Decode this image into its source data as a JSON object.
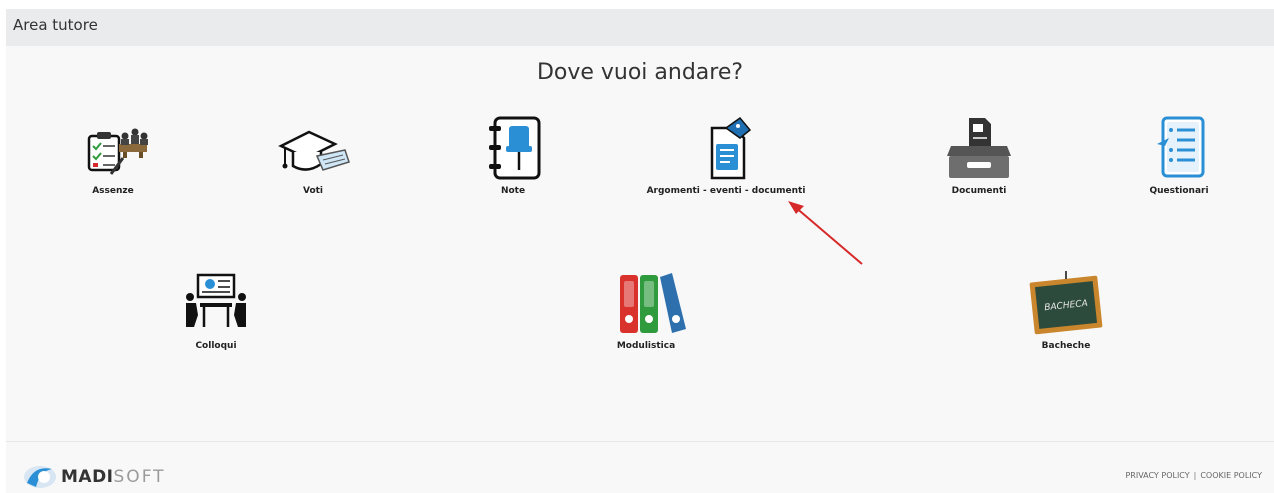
{
  "header": {
    "title": "Area tutore"
  },
  "main": {
    "heading": "Dove vuoi andare?",
    "tiles": [
      {
        "label": "Assenze",
        "icon": "attendance-icon"
      },
      {
        "label": "Voti",
        "icon": "graduation-cap-icon"
      },
      {
        "label": "Note",
        "icon": "notebook-pin-icon"
      },
      {
        "label": "Argomenti - eventi - documenti",
        "icon": "document-tag-icon"
      },
      {
        "label": "Documenti",
        "icon": "document-tray-icon"
      },
      {
        "label": "Questionari",
        "icon": "questionnaire-icon"
      },
      {
        "label": "Colloqui",
        "icon": "meeting-icon"
      },
      {
        "label": "Modulistica",
        "icon": "binders-icon"
      },
      {
        "label": "Bacheche",
        "icon": "blackboard-icon",
        "board_text": "BACHECA"
      }
    ]
  },
  "footer": {
    "logo_bold": "MADI",
    "logo_light": "SOFT",
    "privacy": "PRIVACY POLICY",
    "separator": "|",
    "cookie": "COOKIE POLICY"
  },
  "colors": {
    "accent_blue": "#2b8fd6",
    "arrow_red": "#d62a2a",
    "binder_red": "#d9322c",
    "binder_green": "#2f9a3e",
    "binder_blue": "#2e6fae",
    "board_frame": "#c9862c",
    "board_green": "#2c4b3c"
  }
}
